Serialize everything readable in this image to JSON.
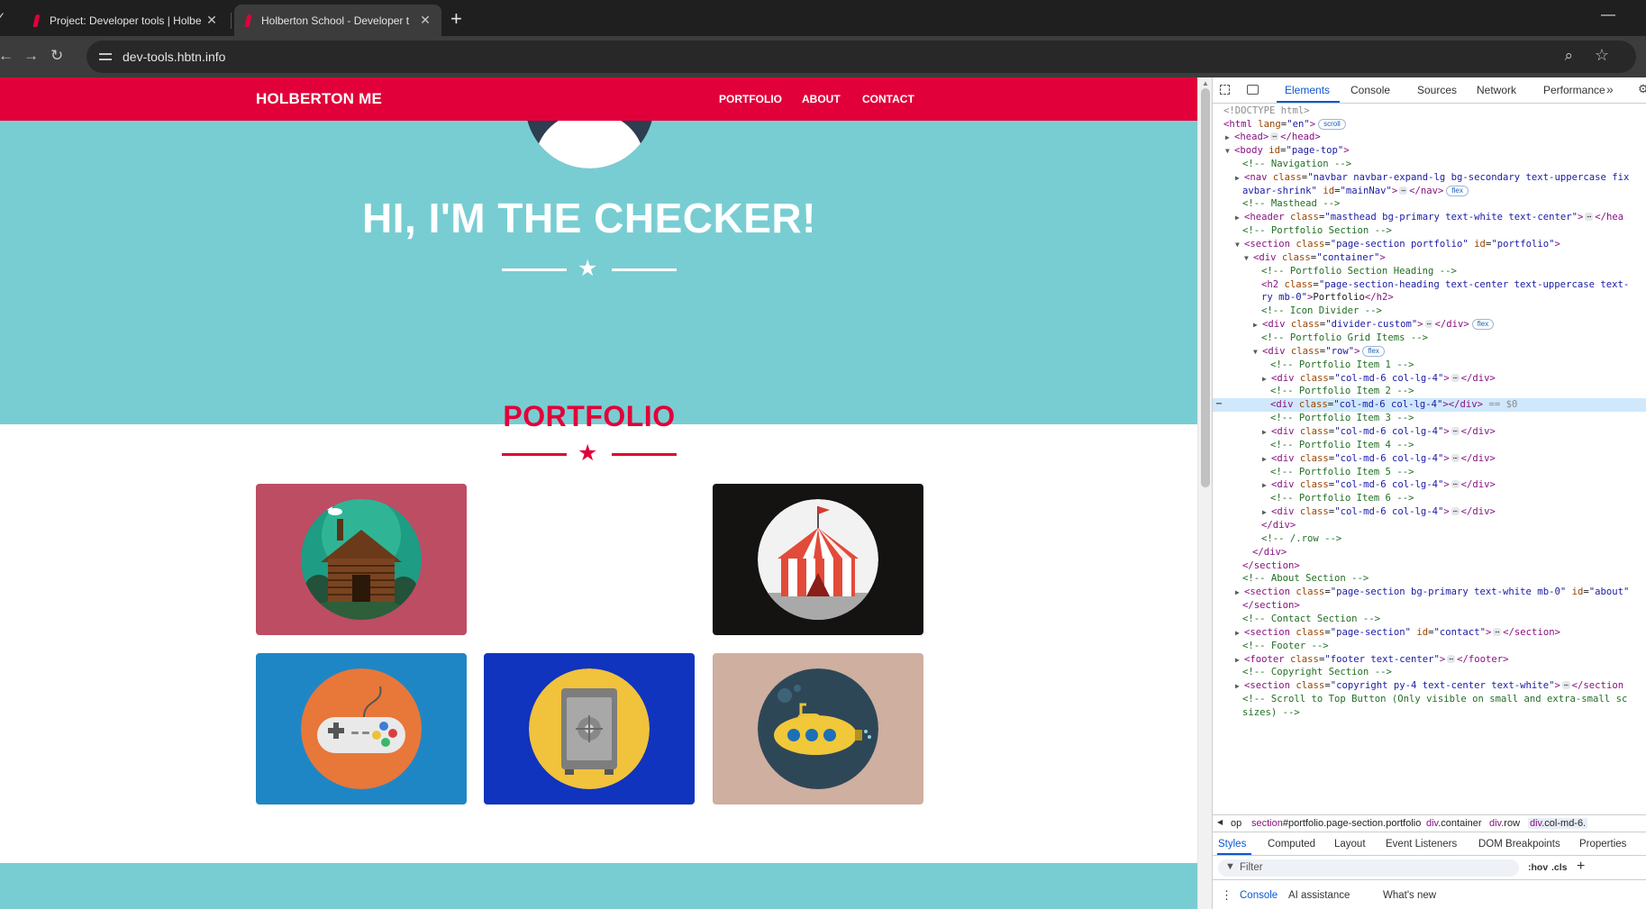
{
  "browser": {
    "tabs": [
      {
        "title": "Project: Developer tools | Holbe",
        "active": false,
        "close": "✕"
      },
      {
        "title": "Holberton School - Developer t",
        "active": true,
        "close": "✕"
      }
    ],
    "new_tab": "+",
    "url": "dev-tools.hbtn.info",
    "window_minimize": "—"
  },
  "site": {
    "brand": "HOLBERTON ME",
    "nav_links": [
      "PORTFOLIO",
      "ABOUT",
      "CONTACT"
    ],
    "hero_title": "HI, I'M THE CHECKER!",
    "portfolio_heading": "PORTFOLIO",
    "divider_star": "★",
    "portfolio_items": [
      {
        "name": "cabin",
        "bg": "#bd4d62"
      },
      {
        "name": "circus-tent",
        "bg": "#151212"
      },
      {
        "name": "game-controller",
        "bg": "#1f86c5"
      },
      {
        "name": "safe",
        "bg": "#1034bd"
      },
      {
        "name": "submarine",
        "bg": "#ceafa0"
      }
    ],
    "colors": {
      "primary": "#e10039",
      "secondary": "#78cdd2"
    }
  },
  "devtools": {
    "tabs": [
      "Elements",
      "Console",
      "Sources",
      "Network",
      "Performance"
    ],
    "more_tabs": "»",
    "active_tab": "Elements",
    "breadcrumbs": {
      "b1": "op",
      "b2_tag": "section",
      "b2_rest": "#portfolio.page-section.portfolio",
      "b3_tag": "div",
      "b3_rest": ".container",
      "b4_tag": "div",
      "b4_rest": ".row",
      "b5_tag": "div",
      "b5_rest": ".col-md-6."
    },
    "styles_tabs": [
      "Styles",
      "Computed",
      "Layout",
      "Event Listeners",
      "DOM Breakpoints",
      "Properties"
    ],
    "filter_placeholder": "Filter",
    "hov": ":hov",
    "cls": ".cls",
    "add_rule": "+",
    "drawer_tabs": [
      "Console",
      "AI assistance",
      "What's new"
    ],
    "dom": {
      "doctype": "<!DOCTYPE html>",
      "html_open": "<html",
      "attr_lang": "lang",
      "val_en": "\"en\"",
      "pill_scroll": "scroll",
      "head": "<head>",
      "head_close": "</head>",
      "body_open": "<body",
      "attr_id": "id",
      "val_page_top": "\"page-top\"",
      "c_navigation": "<!-- Navigation -->",
      "nav_open": "<nav",
      "attr_class": "class",
      "val_nav_1": "\"navbar navbar-expand-lg bg-secondary text-uppercase fix",
      "val_nav_2": "avbar-shrink\"",
      "val_mainnav": "\"mainNav\"",
      "nav_close": "</nav>",
      "pill_flex": "flex",
      "c_masthead": "<!-- Masthead -->",
      "header_open": "<header",
      "val_masthead": "\"masthead bg-primary text-white text-center\"",
      "header_close": "</hea",
      "c_portfolio_section": "<!-- Portfolio Section -->",
      "section_open": "<section",
      "val_page_section_portfolio": "\"page-section portfolio\"",
      "val_portfolio": "\"portfolio\"",
      "div_open": "<div",
      "val_container": "\"container\"",
      "c_portfolio_heading": "<!-- Portfolio Section Heading -->",
      "h2_open": "<h2",
      "val_h2_1": "\"page-section-heading text-center text-uppercase text-",
      "val_h2_2": "ry mb-0\"",
      "h2_text": "Portfolio",
      "h2_close": "</h2>",
      "c_icon_divider": "<!-- Icon Divider -->",
      "val_divider_custom": "\"divider-custom\"",
      "div_close": "</div>",
      "c_grid_items": "<!-- Portfolio Grid Items -->",
      "val_row": "\"row\"",
      "c_item_1": "<!-- Portfolio Item 1 -->",
      "c_item_2": "<!-- Portfolio Item 2 -->",
      "c_item_3": "<!-- Portfolio Item 3 -->",
      "c_item_4": "<!-- Portfolio Item 4 -->",
      "c_item_5": "<!-- Portfolio Item 5 -->",
      "c_item_6": "<!-- Portfolio Item 6 -->",
      "val_col": "\"col-md-6 col-lg-4\"",
      "eq_dollar": "== $0",
      "c_row_end": "<!-- /.row -->",
      "section_close": "</section>",
      "c_about": "<!-- About Section -->",
      "val_about_class": "\"page-section bg-primary text-white mb-0\"",
      "val_about_id": "\"about\"",
      "c_contact": "<!-- Contact Section -->",
      "val_page_section": "\"page-section\"",
      "val_contact": "\"contact\"",
      "c_footer": "<!-- Footer -->",
      "footer_open": "<footer",
      "val_footer": "\"footer text-center\"",
      "footer_close": "</footer>",
      "c_copyright": "<!-- Copyright Section -->",
      "val_copyright": "\"copyright py-4 text-center text-white\"",
      "section_close_cut": "</section",
      "c_scroll_1": "<!-- Scroll to Top Button (Only visible on small and extra-small sc",
      "c_scroll_2": "sizes) -->",
      "gt": ">",
      "eq": "=",
      "ellipsis": "⋯"
    }
  }
}
